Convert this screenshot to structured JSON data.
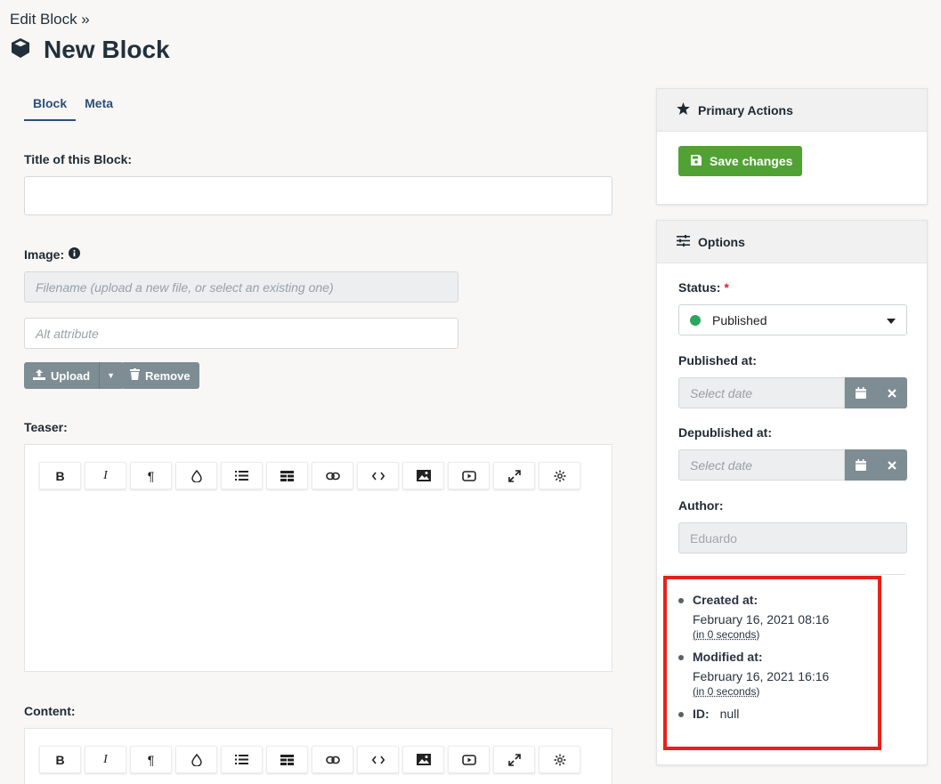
{
  "header": {
    "breadcrumb": "Edit Block »",
    "title": "New Block"
  },
  "tabs": [
    {
      "label": "Block",
      "active": true
    },
    {
      "label": "Meta",
      "active": false
    }
  ],
  "form": {
    "title_label": "Title of this Block:",
    "title_value": "",
    "image_label": "Image:",
    "filename_placeholder": "Filename (upload a new file, or select an existing one)",
    "alt_placeholder": "Alt attribute",
    "upload_label": "Upload",
    "remove_label": "Remove",
    "teaser_label": "Teaser:",
    "content_label": "Content:"
  },
  "toolbar_buttons": [
    "B",
    "I",
    "¶"
  ],
  "primary_actions": {
    "title": "Primary Actions",
    "save_label": "Save changes"
  },
  "options": {
    "title": "Options",
    "status_label": "Status:",
    "required_mark": "*",
    "status_value": "Published",
    "published_at_label": "Published at:",
    "published_at_placeholder": "Select date",
    "depublished_at_label": "Depublished at:",
    "depublished_at_placeholder": "Select date",
    "author_label": "Author:",
    "author_value": "Eduardo"
  },
  "meta": {
    "created_label": "Created at:",
    "created_value": "February 16, 2021 08:16",
    "created_relative": "(in 0 seconds)",
    "modified_label": "Modified at:",
    "modified_value": "February 16, 2021 16:16",
    "modified_relative": "(in 0 seconds)",
    "id_label": "ID:",
    "id_value": "null"
  },
  "colors": {
    "accent_green": "#51a234",
    "status_green": "#2aa65e",
    "button_gray": "#7d8d93",
    "highlight_red": "#e8201a"
  }
}
